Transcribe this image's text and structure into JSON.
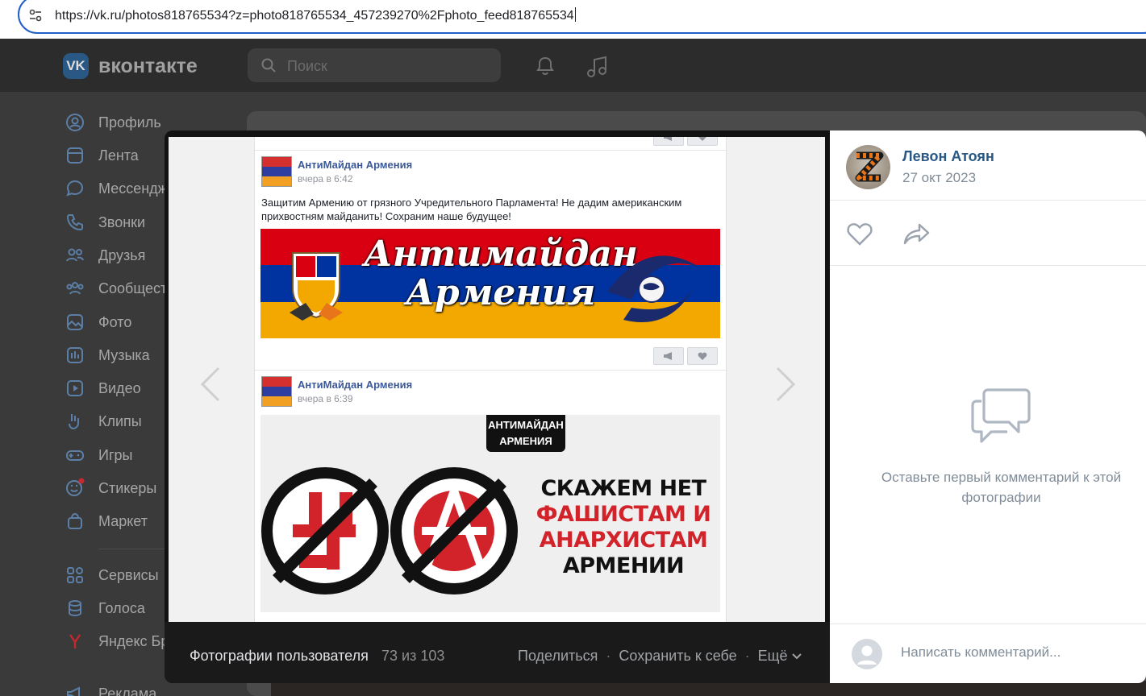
{
  "browser": {
    "url": "https://vk.ru/photos818765534?z=photo818765534_457239270%2Fphoto_feed818765534"
  },
  "vk": {
    "logo_mark": "VK",
    "logo_text": "вконтакте",
    "search_placeholder": "Поиск",
    "sidebar": [
      {
        "label": "Профиль",
        "icon": "profile-icon"
      },
      {
        "label": "Лента",
        "icon": "feed-icon"
      },
      {
        "label": "Мессендж",
        "icon": "messenger-icon"
      },
      {
        "label": "Звонки",
        "icon": "calls-icon"
      },
      {
        "label": "Друзья",
        "icon": "friends-icon"
      },
      {
        "label": "Сообщест",
        "icon": "communities-icon"
      },
      {
        "label": "Фото",
        "icon": "photo-icon"
      },
      {
        "label": "Музыка",
        "icon": "music-icon"
      },
      {
        "label": "Видео",
        "icon": "video-icon"
      },
      {
        "label": "Клипы",
        "icon": "clips-icon"
      },
      {
        "label": "Игры",
        "icon": "games-icon"
      },
      {
        "label": "Стикеры",
        "icon": "stickers-icon"
      },
      {
        "label": "Маркет",
        "icon": "market-icon"
      },
      {
        "label": "Сервисы",
        "icon": "services-icon"
      },
      {
        "label": "Голоса",
        "icon": "votes-icon"
      },
      {
        "label": "Яндекс Бр",
        "icon": "yandex-icon"
      },
      {
        "label": "Реклама",
        "icon": "ads-icon"
      }
    ]
  },
  "viewer": {
    "photo": {
      "posts": [
        {
          "author": "АнтиМайдан Армения",
          "time": "вчера в 6:42",
          "text": "Защитим Армению от грязного Учредительного Парламента! Не дадим американским прихвостням майданить! Сохраним наше будущее!",
          "banner_line1": "Антимайдан",
          "banner_line2": "Армения"
        },
        {
          "author": "АнтиМайдан Армения",
          "time": "вчера в 6:39",
          "badge_line1": "АНТИМАЙДАН",
          "badge_line2": "АРМЕНИЯ",
          "slogan1": "СКАЖЕМ НЕТ",
          "slogan2": "ФАШИСТАМ И",
          "slogan3": "АНАРХИСТАМ",
          "slogan4": "АРМЕНИИ"
        }
      ]
    },
    "footer": {
      "album": "Фотографии пользователя",
      "counter": "73 из 103",
      "share": "Поделиться",
      "save": "Сохранить к себе",
      "more": "Ещё"
    },
    "side": {
      "author_name": "Левон Атоян",
      "date": "27 окт 2023",
      "empty_comments": "Оставьте первый комментарий к этой фотографии",
      "comment_placeholder": "Написать комментарий..."
    }
  },
  "colors": {
    "vk_blue": "#2a5885",
    "armenia_red": "#d90012",
    "armenia_blue": "#0033a0",
    "armenia_orange": "#f2a800",
    "url_focus": "#1f5fc7"
  }
}
